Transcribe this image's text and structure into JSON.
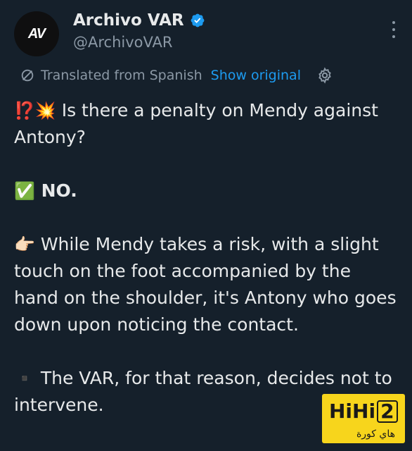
{
  "account": {
    "name": "Archivo VAR",
    "handle": "@ArchivoVAR",
    "avatar_logo": "AV",
    "verified_color": "#1d9bf0"
  },
  "translation": {
    "label": "Translated from Spanish",
    "show_original": "Show original"
  },
  "tweet": {
    "line1_emoji": "⁉️💥",
    "line1_text": " Is there a penalty on Mendy against Antony?",
    "line2_emoji": "✅",
    "line2_text": " NO.",
    "line3_emoji": "👉🏻",
    "line3_text": " While Mendy takes a risk, with a slight touch on the foot accompanied by the hand on the shoulder, it's Antony who goes down upon noticing the contact.",
    "line4_emoji": "▪️",
    "line4_text": " The VAR, for that reason, decides not to intervene."
  },
  "watermark": {
    "brand": "HiHi",
    "number": "2",
    "arabic": "هاي كورة"
  },
  "icons": [
    "avatar",
    "verified-icon",
    "more-icon",
    "translate-icon",
    "gear-icon"
  ]
}
